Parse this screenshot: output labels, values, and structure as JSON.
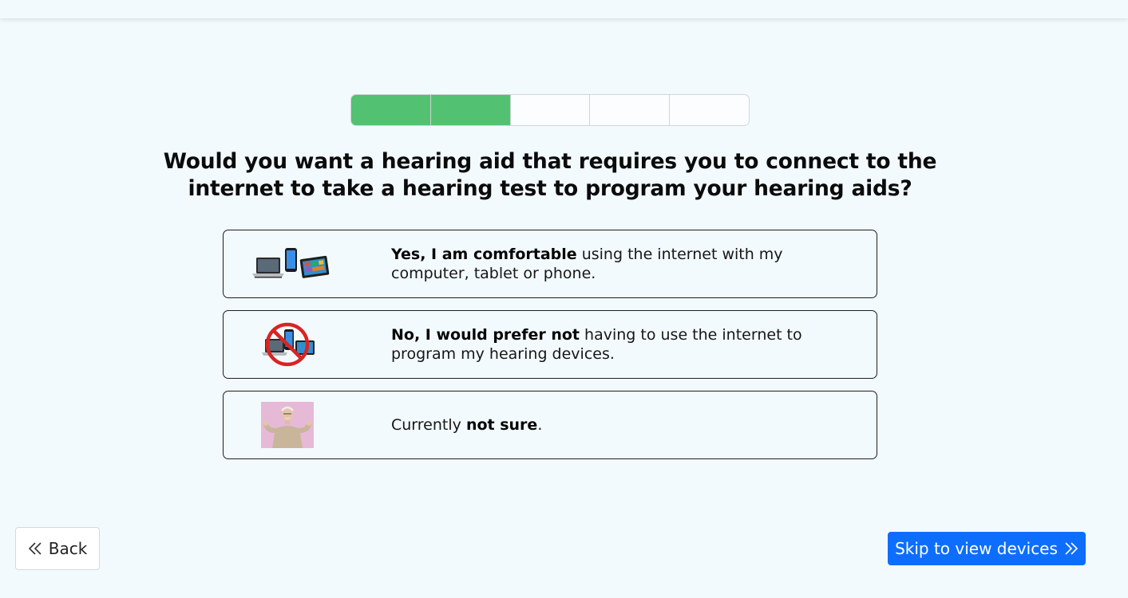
{
  "progress": {
    "total_steps": 5,
    "completed_steps": 2,
    "fill_color": "#52c272"
  },
  "question": {
    "text": "Would you want a hearing aid that requires you to connect to the internet to take a hearing test to program your hearing aids?"
  },
  "options": [
    {
      "image": "devices-image",
      "bold": "Yes, I am comfortable",
      "rest": " using the internet with my computer, tablet or phone."
    },
    {
      "image": "no-devices-image",
      "bold": "No, I would prefer not",
      "rest": " having to use the internet to program my hearing devices."
    },
    {
      "image": "unsure-person-image",
      "prefix": "Currently ",
      "bold": "not sure",
      "suffix": "."
    }
  ],
  "footer": {
    "back_label": "Back",
    "back_icon": "chevrons-left-icon",
    "skip_label": "Skip to view devices",
    "skip_icon": "chevrons-right-icon",
    "skip_color": "#0d6efd"
  }
}
